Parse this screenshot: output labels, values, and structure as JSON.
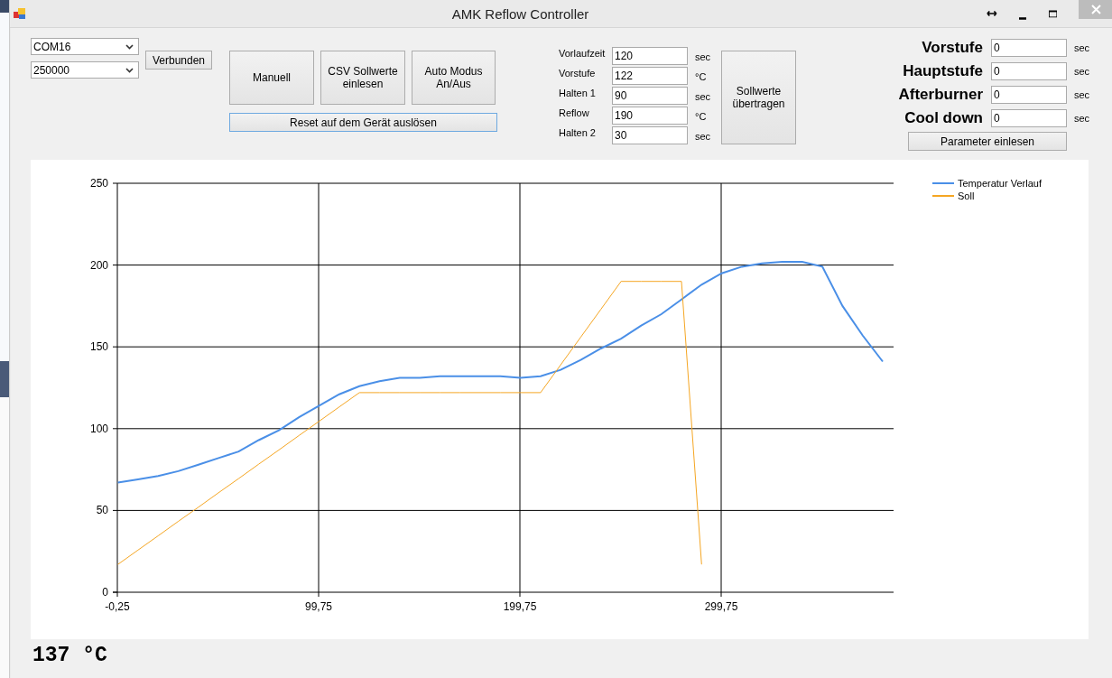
{
  "window": {
    "title": "AMK Reflow Controller"
  },
  "connection": {
    "port": "COM16",
    "baud": "250000",
    "connect_button": "Verbunden"
  },
  "mode_buttons": [
    "Manuell",
    "CSV Sollwerte einlesen",
    "Auto Modus An/Aus"
  ],
  "reset_button": "Reset auf dem Gerät auslösen",
  "setpoints": [
    {
      "label": "Vorlaufzeit",
      "value": "120",
      "unit": "sec"
    },
    {
      "label": "Vorstufe",
      "value": "122",
      "unit": "°C"
    },
    {
      "label": "Halten 1",
      "value": "90",
      "unit": "sec"
    },
    {
      "label": "Reflow",
      "value": "190",
      "unit": "°C"
    },
    {
      "label": "Halten 2",
      "value": "30",
      "unit": "sec"
    }
  ],
  "transfer_button": "Sollwerte übertragen",
  "parameters": [
    {
      "label": "Vorstufe",
      "value": "0",
      "unit": "sec"
    },
    {
      "label": "Hauptstufe",
      "value": "0",
      "unit": "sec"
    },
    {
      "label": "Afterburner",
      "value": "0",
      "unit": "sec"
    },
    {
      "label": "Cool down",
      "value": "0",
      "unit": "sec"
    }
  ],
  "read_button": "Parameter einlesen",
  "chart": {
    "chart_data": {
      "type": "line",
      "grid": true,
      "legend": true,
      "xlim": [
        -0.25,
        385.4
      ],
      "ylim": [
        0,
        250
      ],
      "xticks": [
        {
          "value": -0.25,
          "label": "-0,25"
        },
        {
          "value": 99.75,
          "label": "99,75"
        },
        {
          "value": 199.75,
          "label": "199,75"
        },
        {
          "value": 299.75,
          "label": "299,75"
        }
      ],
      "yticks": [
        0,
        50,
        100,
        150,
        200,
        250
      ],
      "x": [
        0,
        10,
        20,
        30,
        40,
        50,
        60,
        70,
        80,
        90,
        100,
        110,
        120,
        130,
        140,
        150,
        160,
        170,
        180,
        190,
        200,
        210,
        220,
        230,
        240,
        250,
        260,
        270,
        280,
        290,
        300,
        310,
        320,
        330,
        340,
        350,
        360,
        370,
        380
      ],
      "series": [
        {
          "name": "Temperatur Verlauf",
          "color": "#4a8fe7",
          "values": [
            67,
            69,
            71,
            74,
            78,
            82,
            86,
            93,
            99,
            107,
            114,
            121,
            126,
            129,
            131,
            131,
            132,
            132,
            132,
            132,
            131,
            132,
            136,
            142,
            149,
            155,
            163,
            170,
            179,
            188,
            195,
            199,
            201,
            202,
            202,
            199,
            175,
            157,
            141
          ]
        },
        {
          "name": "Soll",
          "color": "#f5a623",
          "values": [
            17,
            25.8,
            34.5,
            43.3,
            52,
            60.8,
            69.5,
            78.3,
            87,
            95.8,
            104.5,
            113.3,
            122,
            122,
            122,
            122,
            122,
            122,
            122,
            122,
            122,
            122,
            139,
            156,
            173,
            190,
            190,
            190,
            190,
            17,
            null,
            null,
            null,
            null,
            null,
            null,
            null,
            null,
            null
          ]
        }
      ]
    }
  },
  "temperature_reading": "137 °C"
}
